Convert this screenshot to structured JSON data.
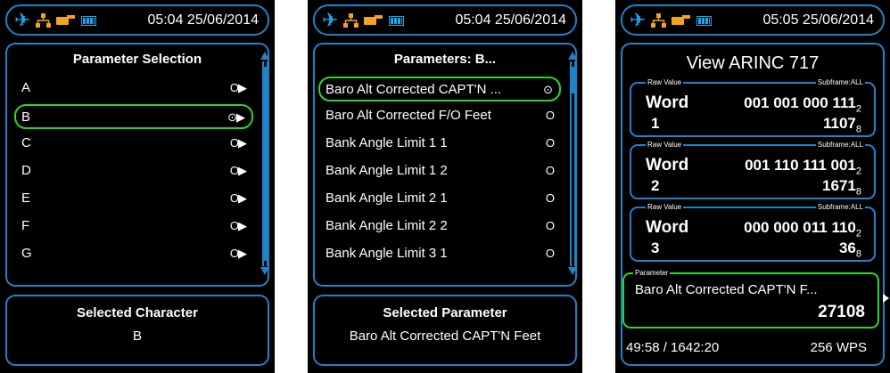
{
  "colors": {
    "frame": "#1f83c8",
    "selection": "#2ed62a",
    "background": "#000000",
    "text": "#ffffff",
    "battery": "#f3a41a"
  },
  "icons": [
    "airplane-icon",
    "network-icon",
    "battery-pack-icon",
    "signal-level-icon"
  ],
  "screens": [
    {
      "datetime": "05:04 25/06/2014",
      "list_title": "Parameter Selection",
      "items": [
        {
          "label": "A",
          "end": "O▶"
        },
        {
          "label": "B",
          "end": "⊙▶",
          "selected": true
        },
        {
          "label": "C",
          "end": "O▶"
        },
        {
          "label": "D",
          "end": "O▶"
        },
        {
          "label": "E",
          "end": "O▶"
        },
        {
          "label": "F",
          "end": "O▶"
        },
        {
          "label": "G",
          "end": "O▶"
        }
      ],
      "bottom_title": "Selected Character",
      "bottom_value": "B"
    },
    {
      "datetime": "05:04 25/06/2014",
      "list_title": "Parameters: B...",
      "items": [
        {
          "label": "Baro Alt Corrected CAPT'N ...",
          "end": "⊙",
          "selected": true
        },
        {
          "label": "Baro Alt Corrected F/O Feet",
          "end": "O"
        },
        {
          "label": "Bank Angle Limit 1 1",
          "end": "O"
        },
        {
          "label": "Bank Angle Limit 1 2",
          "end": "O"
        },
        {
          "label": "Bank Angle Limit 2 1",
          "end": "O"
        },
        {
          "label": "Bank Angle Limit 2 2",
          "end": "O"
        },
        {
          "label": "Bank Angle Limit 3 1",
          "end": "O"
        }
      ],
      "bottom_title": "Selected Parameter",
      "bottom_value": "Baro Alt Corrected CAPT'N Feet"
    },
    {
      "datetime": "05:05 25/06/2014",
      "title": "View ARINC 717",
      "words": [
        {
          "legend_left": "Raw Value",
          "legend_right": "Subframe:ALL",
          "label": "Word",
          "number": "1",
          "binary": "001 001 000 111",
          "binary_base": "2",
          "octal": "1107",
          "octal_base": "8"
        },
        {
          "legend_left": "Raw Value",
          "legend_right": "Subframe:ALL",
          "label": "Word",
          "number": "2",
          "binary": "001 110 111 001",
          "binary_base": "2",
          "octal": "1671",
          "octal_base": "8"
        },
        {
          "legend_left": "Raw Value",
          "legend_right": "Subframe:ALL",
          "label": "Word",
          "number": "3",
          "binary": "000 000 011 110",
          "binary_base": "2",
          "octal": "36",
          "octal_base": "8"
        }
      ],
      "parameter_legend": "Parameter",
      "parameter_name": "Baro Alt Corrected CAPT'N F...",
      "parameter_value": "27108",
      "elapsed": "49:58 / 1642:20",
      "rate": "256 WPS"
    }
  ]
}
